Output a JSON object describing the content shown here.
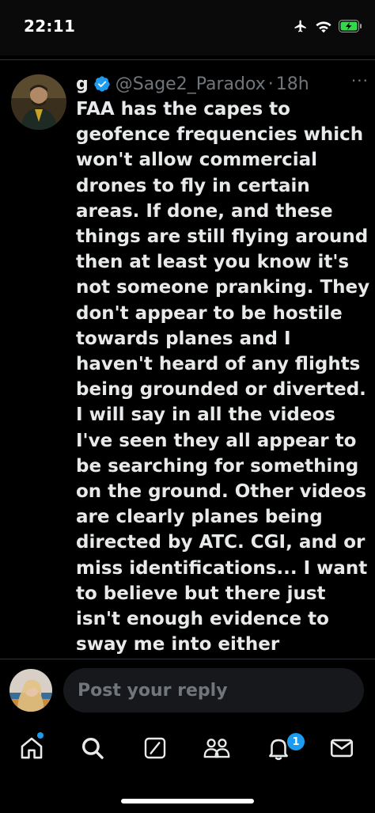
{
  "status_bar": {
    "time": "22:11"
  },
  "tweet": {
    "author_name": "g",
    "author_handle": "@Sage2_Paradox",
    "separator": "·",
    "time_ago": "18h",
    "more_label": "···",
    "text": "FAA has the capes to geofence frequencies which won't allow commercial drones to fly in certain areas. If done, and these things are still flying around then at least you know it's not someone pranking. They don't appear to be hostile towards planes and I haven't heard of any flights being grounded or diverted. I will say in all the videos I've seen they all appear to be searching for something on the ground. Other videos are clearly planes being directed by ATC. CGI, and or miss identifications... I want to believe but there just isn't enough evidence to sway me into either direction at the",
    "verified_color": "#1d9bf0"
  },
  "reply": {
    "placeholder": "Post your reply"
  },
  "nav": {
    "items": [
      "home-icon",
      "search-icon",
      "grok-icon",
      "communities-icon",
      "notifications-icon",
      "messages-icon"
    ],
    "notification_count": "1"
  },
  "colors": {
    "accent": "#1d9bf0",
    "text": "#e7e9ea",
    "muted": "#71767b",
    "background": "#000000"
  }
}
